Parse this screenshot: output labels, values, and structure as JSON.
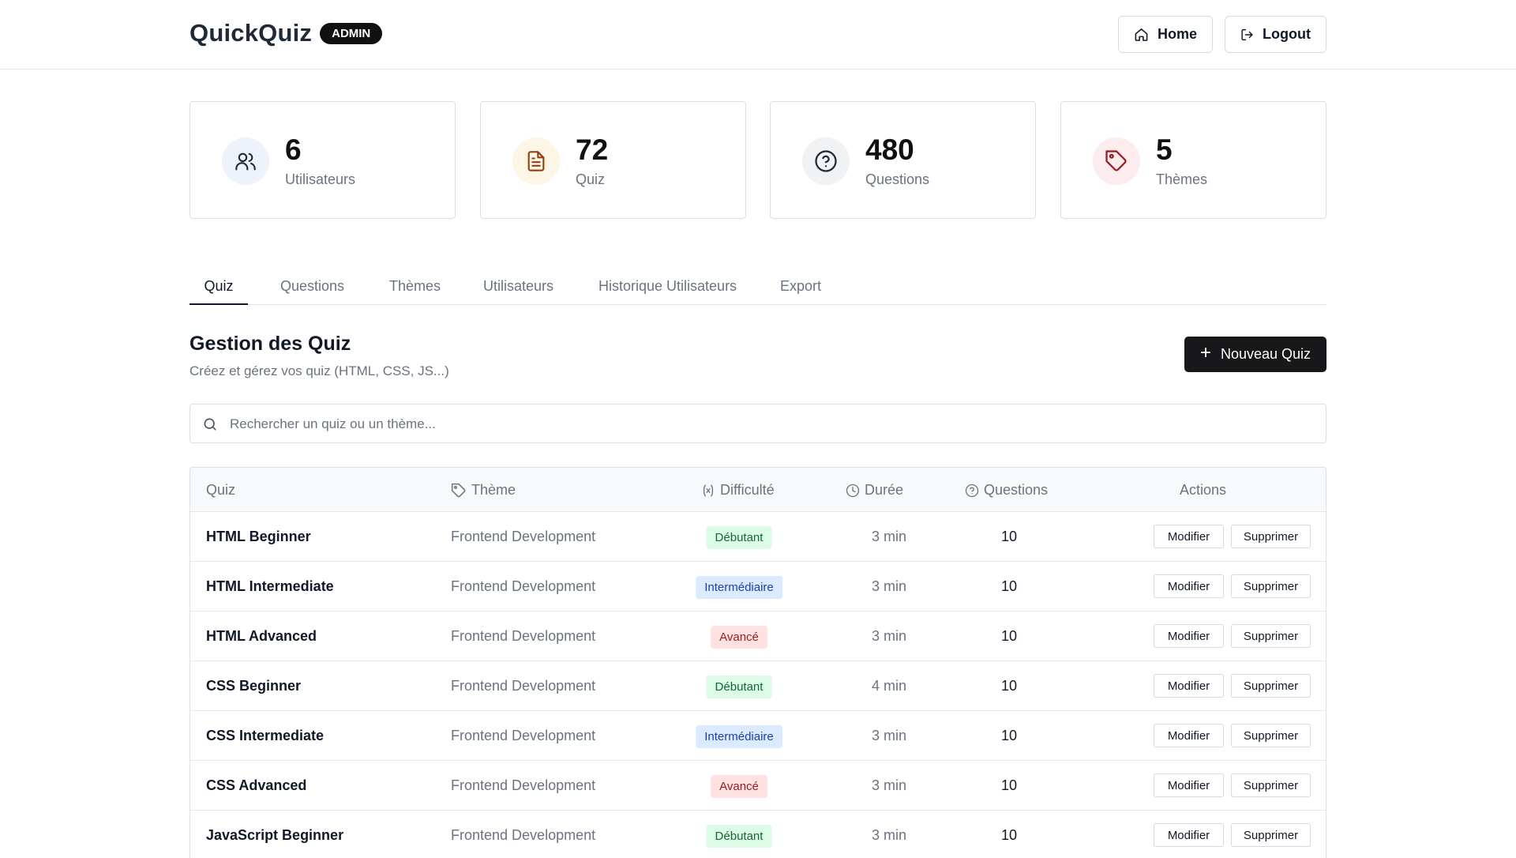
{
  "header": {
    "brand": "QuickQuiz",
    "badge": "ADMIN",
    "home_label": "Home",
    "logout_label": "Logout"
  },
  "stats": [
    {
      "value": "6",
      "label": "Utilisateurs",
      "icon": "users-icon",
      "color": "#eef2fb"
    },
    {
      "value": "72",
      "label": "Quiz",
      "icon": "document-icon",
      "color": "#fdf6e7"
    },
    {
      "value": "480",
      "label": "Questions",
      "icon": "question-circle-icon",
      "color": "#f1f2f3"
    },
    {
      "value": "5",
      "label": "Thèmes",
      "icon": "tag-icon",
      "color": "#fdeced"
    }
  ],
  "tabs": [
    {
      "label": "Quiz",
      "active": true
    },
    {
      "label": "Questions",
      "active": false
    },
    {
      "label": "Thèmes",
      "active": false
    },
    {
      "label": "Utilisateurs",
      "active": false
    },
    {
      "label": "Historique Utilisateurs",
      "active": false
    },
    {
      "label": "Export",
      "active": false
    }
  ],
  "section": {
    "title": "Gestion des Quiz",
    "subtitle": "Créez et gérez vos quiz (HTML, CSS, JS...)",
    "new_button": "Nouveau Quiz"
  },
  "search": {
    "placeholder": "Rechercher un quiz ou un thème...",
    "value": ""
  },
  "table": {
    "columns": {
      "quiz": "Quiz",
      "theme": "Thème",
      "difficulty": "Difficulté",
      "duration": "Durée",
      "questions": "Questions",
      "actions": "Actions"
    },
    "edit_label": "Modifier",
    "delete_label": "Supprimer",
    "rows": [
      {
        "name": "HTML Beginner",
        "theme": "Frontend Development",
        "difficulty": "Débutant",
        "level": "debutant",
        "duration": "3 min",
        "questions": "10"
      },
      {
        "name": "HTML Intermediate",
        "theme": "Frontend Development",
        "difficulty": "Intermédiaire",
        "level": "inter",
        "duration": "3 min",
        "questions": "10"
      },
      {
        "name": "HTML Advanced",
        "theme": "Frontend Development",
        "difficulty": "Avancé",
        "level": "avance",
        "duration": "3 min",
        "questions": "10"
      },
      {
        "name": "CSS Beginner",
        "theme": "Frontend Development",
        "difficulty": "Débutant",
        "level": "debutant",
        "duration": "4 min",
        "questions": "10"
      },
      {
        "name": "CSS Intermediate",
        "theme": "Frontend Development",
        "difficulty": "Intermédiaire",
        "level": "inter",
        "duration": "3 min",
        "questions": "10"
      },
      {
        "name": "CSS Advanced",
        "theme": "Frontend Development",
        "difficulty": "Avancé",
        "level": "avance",
        "duration": "3 min",
        "questions": "10"
      },
      {
        "name": "JavaScript Beginner",
        "theme": "Frontend Development",
        "difficulty": "Débutant",
        "level": "debutant",
        "duration": "3 min",
        "questions": "10"
      }
    ]
  }
}
